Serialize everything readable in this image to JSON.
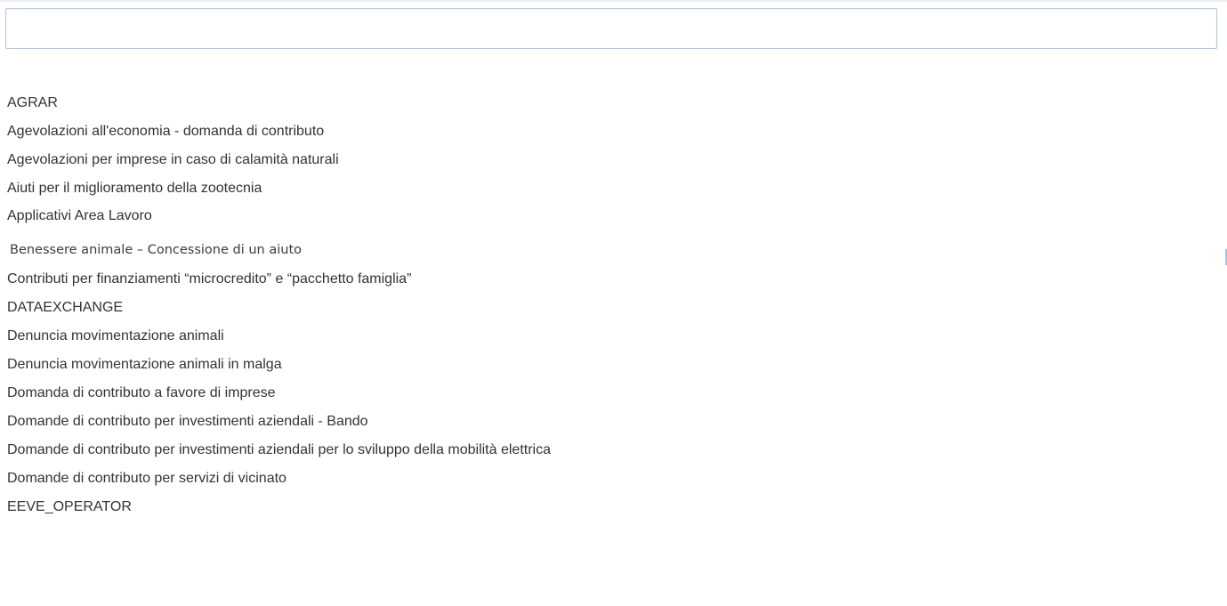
{
  "search": {
    "value": "",
    "placeholder": ""
  },
  "options": [
    {
      "label": "AGRAR"
    },
    {
      "label": "Agevolazioni all'economia - domanda di contributo"
    },
    {
      "label": "Agevolazioni per imprese in caso di calamità naturali"
    },
    {
      "label": "Aiuti per il miglioramento della zootecnia"
    },
    {
      "label": "Applicativi Area Lavoro"
    },
    {
      "label": "Benessere animale – Concessione di un aiuto"
    },
    {
      "label": "Contributi per finanziamenti “microcredito” e “pacchetto famiglia”"
    },
    {
      "label": "DATAEXCHANGE"
    },
    {
      "label": "Denuncia movimentazione animali"
    },
    {
      "label": "Denuncia movimentazione animali in malga"
    },
    {
      "label": "Domanda di contributo a favore di imprese"
    },
    {
      "label": "Domande di contributo per investimenti aziendali - Bando"
    },
    {
      "label": "Domande di contributo per investimenti aziendali per lo sviluppo della mobilità elettrica"
    },
    {
      "label": "Domande di contributo per servizi di vicinato"
    },
    {
      "label": "EEVE_OPERATOR"
    }
  ]
}
